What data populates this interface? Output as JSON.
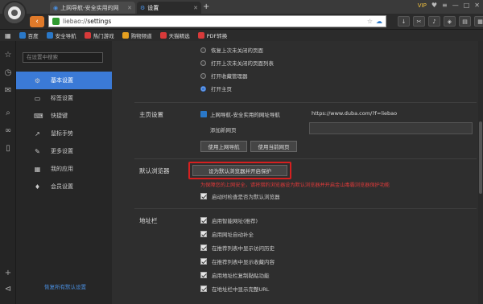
{
  "colors": {
    "accent": "#3b7ad6",
    "brand_orange": "#e07a2a",
    "warning_red": "#e03a3a",
    "link_blue": "#4a90e2"
  },
  "tabs": [
    {
      "label": "上网导航-安全实用的网",
      "icon": "globe-icon"
    },
    {
      "label": "设置",
      "icon": "gear-icon"
    }
  ],
  "window": {
    "vip_label": "VIP"
  },
  "address": {
    "prefix": "liebao://",
    "path": "settings"
  },
  "bookmarks": [
    {
      "label": "百度",
      "color": "#2a78c8"
    },
    {
      "label": "安全导航",
      "color": "#2a78c8"
    },
    {
      "label": "热门游戏",
      "color": "#d83a3a"
    },
    {
      "label": "购物频道",
      "color": "#e6a020"
    },
    {
      "label": "天猫精选",
      "color": "#d83a3a"
    },
    {
      "label": "PDF转换",
      "color": "#d83a3a"
    }
  ],
  "sidebar": {
    "search_placeholder": "在设置中搜索",
    "items": [
      {
        "label": "基本设置",
        "icon": "gear-icon",
        "glyph": "⚙"
      },
      {
        "label": "标签设置",
        "icon": "tab-icon",
        "glyph": "▭"
      },
      {
        "label": "快捷键",
        "icon": "keyboard-icon",
        "glyph": "⌨"
      },
      {
        "label": "鼠标手势",
        "icon": "mouse-icon",
        "glyph": "↗"
      },
      {
        "label": "更多设置",
        "icon": "wrench-icon",
        "glyph": "✎"
      },
      {
        "label": "我的应用",
        "icon": "apps-icon",
        "glyph": "▦"
      },
      {
        "label": "会员设置",
        "icon": "member-icon",
        "glyph": "♦"
      }
    ],
    "restore_label": "恢复所有默认设置"
  },
  "startup": {
    "options": [
      {
        "label": "恢复上次未关闭的页面",
        "selected": false
      },
      {
        "label": "打开上次未关闭的页面列表",
        "selected": false
      },
      {
        "label": "打开收藏管理器",
        "selected": false
      },
      {
        "label": "打开主页",
        "selected": true
      }
    ]
  },
  "homepage": {
    "section_label": "主页设置",
    "site_name": "上网导航-安全实用的网址导航",
    "site_url": "https://www.duba.com/?f=liebao",
    "add_label": "添加新网页",
    "btn_nav": "使用上网导航",
    "btn_current": "使用当前网页"
  },
  "default_browser": {
    "section_label": "默认浏览器",
    "button_label": "设为默认浏览器并开启保护",
    "warning": "为保障您的上网安全，请将猎豹浏览器设为默认浏览器并开启金山毒霸浏览器保护功能",
    "check_label": "启动时检查是否为默认浏览器"
  },
  "address_bar": {
    "section_label": "地址栏",
    "checks": [
      "启用智能网址(推荐)",
      "启用网址自动补全",
      "在推荐列表中显示访问历史",
      "在推荐列表中显示收藏内容",
      "启用地址栏复制黏贴功能",
      "在地址栏中显示完整URL"
    ]
  }
}
